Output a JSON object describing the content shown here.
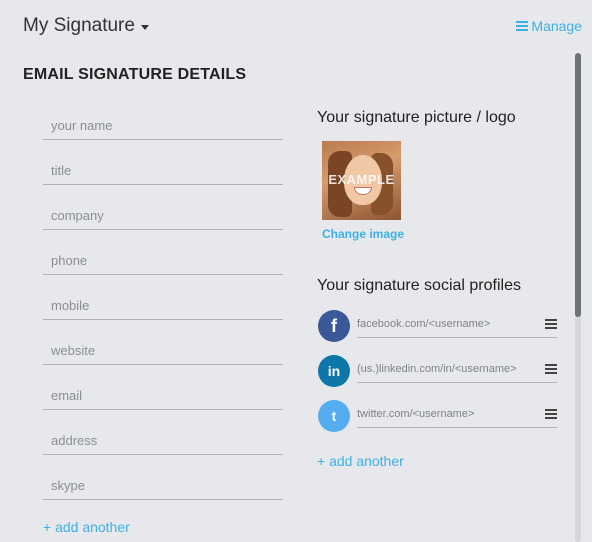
{
  "header": {
    "title": "My Signature",
    "manage_label": "Manage"
  },
  "section_heading": "EMAIL SIGNATURE DETAILS",
  "fields": [
    {
      "placeholder": "your name"
    },
    {
      "placeholder": "title"
    },
    {
      "placeholder": "company"
    },
    {
      "placeholder": "phone"
    },
    {
      "placeholder": "mobile"
    },
    {
      "placeholder": "website"
    },
    {
      "placeholder": "email"
    },
    {
      "placeholder": "address"
    },
    {
      "placeholder": "skype"
    }
  ],
  "add_field_label": "+ add another",
  "picture": {
    "heading": "Your signature picture / logo",
    "overlay_text": "EXAMPLE",
    "change_label": "Change image"
  },
  "social": {
    "heading": "Your signature social profiles",
    "profiles": [
      {
        "icon": "facebook-icon",
        "glyph": "f",
        "color": "#3b5998",
        "placeholder": "facebook.com/<username>"
      },
      {
        "icon": "linkedin-icon",
        "glyph": "in",
        "color": "#0e76a8",
        "placeholder": "(us.)linkedin.com/in/<username>"
      },
      {
        "icon": "twitter-icon",
        "glyph": "t",
        "color": "#55acee",
        "placeholder": "twitter.com/<username>"
      }
    ],
    "add_label": "+ add another"
  },
  "colors": {
    "accent": "#3eb1e4",
    "background": "#e6e8ec"
  }
}
